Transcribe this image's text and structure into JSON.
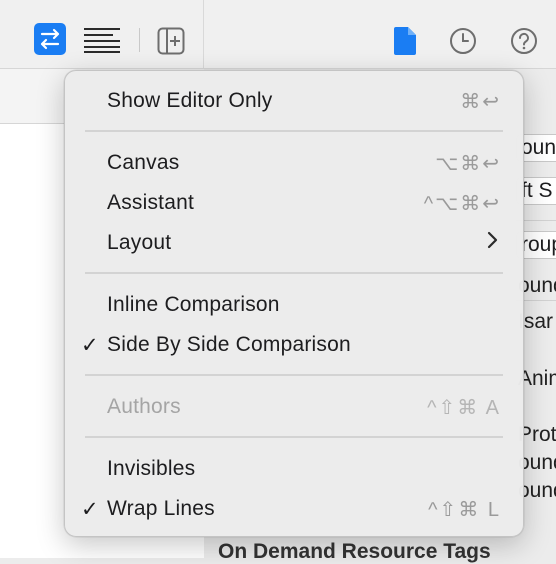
{
  "toolbar": {
    "icons": [
      "swap-arrows-icon",
      "text-lines-icon",
      "add-editor-icon",
      "file-icon",
      "history-clock-icon",
      "help-icon"
    ]
  },
  "inspector": {
    "fields": [
      "ound",
      "ft S",
      "roup"
    ],
    "texts": [
      "ound",
      "Isar",
      "Anim",
      "Prot",
      "ound",
      "ound"
    ],
    "section_title": "On Demand Resource Tags"
  },
  "menu": {
    "items": [
      {
        "label": "Show Editor Only",
        "shortcut": "⌘↩",
        "checked": false,
        "disabled": false
      },
      {
        "label": "Canvas",
        "shortcut": "⌥⌘↩",
        "checked": false,
        "disabled": false
      },
      {
        "label": "Assistant",
        "shortcut": "^⌥⌘↩",
        "checked": false,
        "disabled": false
      },
      {
        "label": "Layout",
        "shortcut": "",
        "submenu": true,
        "checked": false,
        "disabled": false
      },
      {
        "label": "Inline Comparison",
        "shortcut": "",
        "checked": false,
        "disabled": false
      },
      {
        "label": "Side By Side Comparison",
        "shortcut": "",
        "checked": true,
        "disabled": false
      },
      {
        "label": "Authors",
        "shortcut": "^⇧⌘ A",
        "checked": false,
        "disabled": true
      },
      {
        "label": "Invisibles",
        "shortcut": "",
        "checked": false,
        "disabled": false
      },
      {
        "label": "Wrap Lines",
        "shortcut": "^⇧⌘ L",
        "checked": true,
        "disabled": false
      }
    ],
    "check_glyph": "✓",
    "submenu_glyph": "›"
  },
  "colors": {
    "accent": "#1a7df3",
    "icon_gray": "#6e6e6e"
  }
}
